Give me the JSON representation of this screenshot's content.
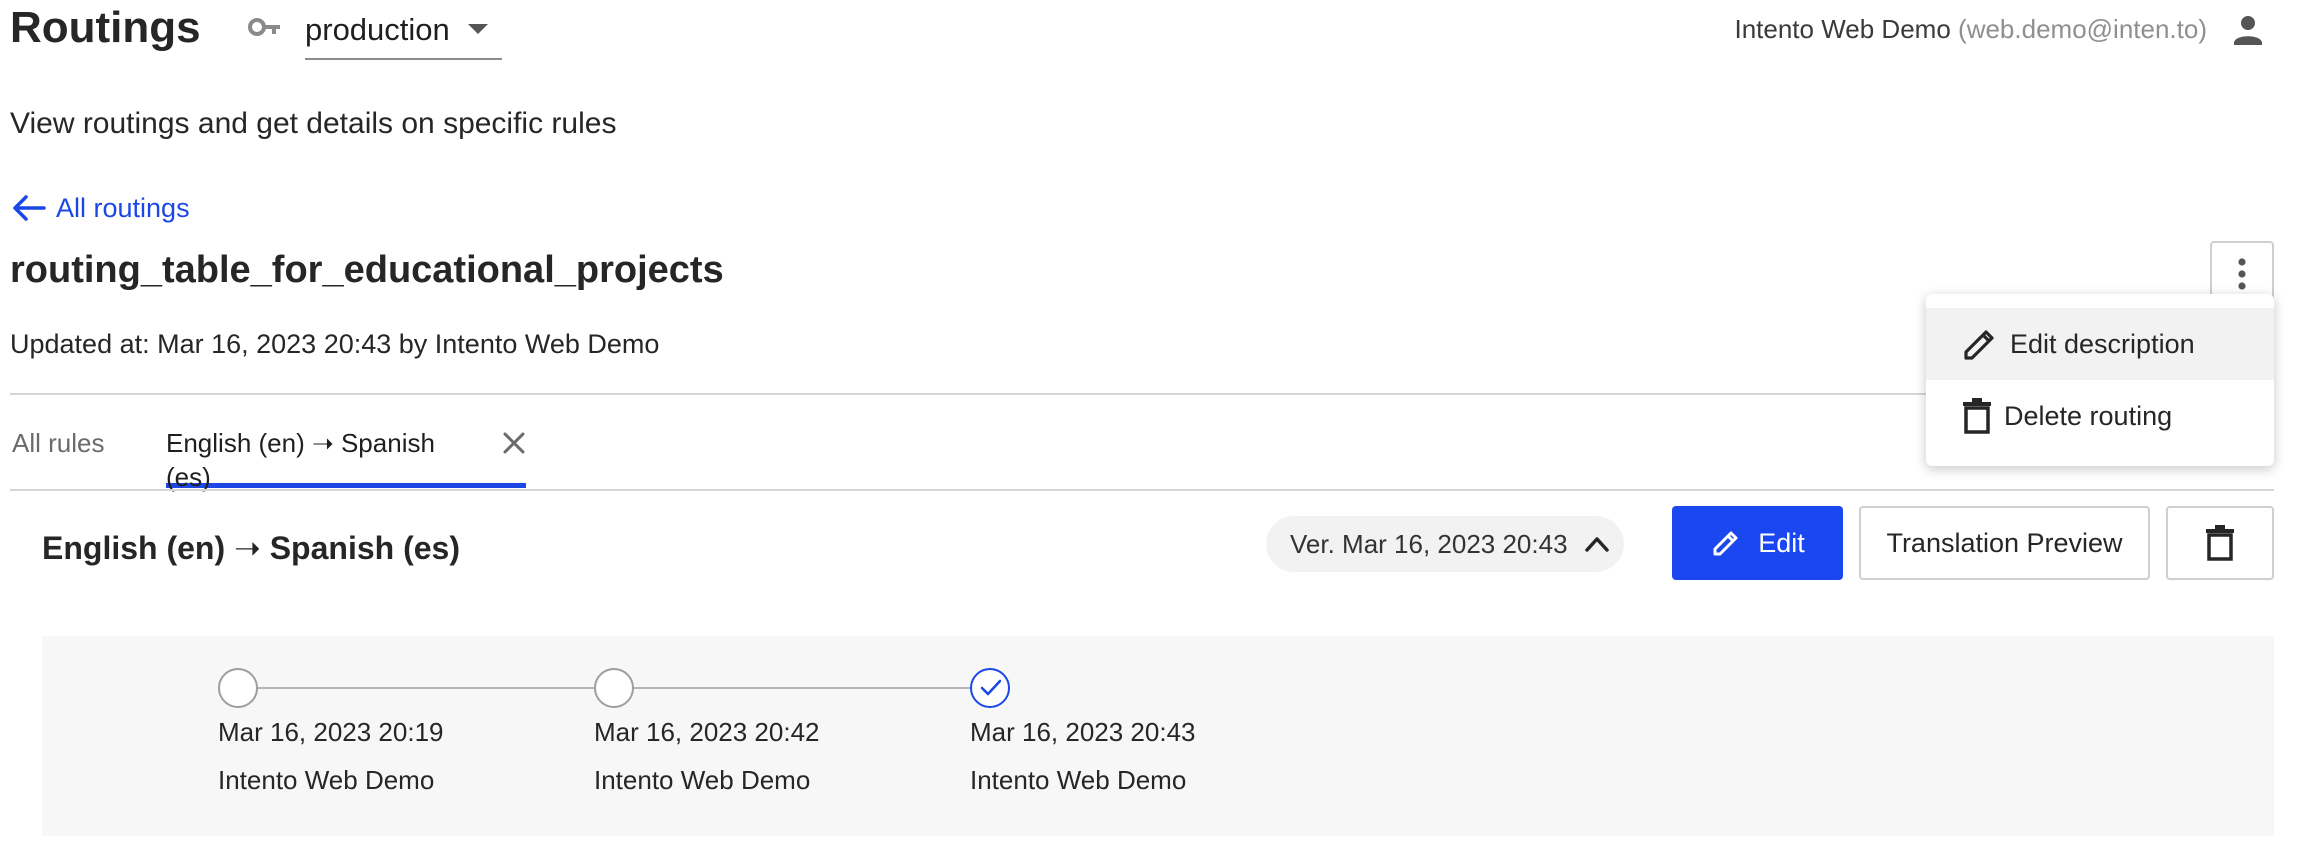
{
  "header": {
    "title": "Routings",
    "environment": "production",
    "user_name": "Intento Web Demo",
    "user_email": "(web.demo@inten.to)"
  },
  "subtitle": "View routings and get details on specific rules",
  "back_link": "All routings",
  "routing": {
    "name": "routing_table_for_educational_projects",
    "updated": "Updated at: Mar 16, 2023 20:43 by Intento Web Demo"
  },
  "tabs": [
    {
      "label": "All rules"
    },
    {
      "label": "English (en) ➝ Spanish (es)"
    }
  ],
  "rule": {
    "title": "English (en) ➝ Spanish (es)",
    "version": "Ver. Mar 16, 2023 20:43",
    "edit_label": "Edit",
    "preview_label": "Translation Preview"
  },
  "history": [
    {
      "date": "Mar 16, 2023 20:19",
      "author": "Intento Web Demo",
      "current": false
    },
    {
      "date": "Mar 16, 2023 20:42",
      "author": "Intento Web Demo",
      "current": false
    },
    {
      "date": "Mar 16, 2023 20:43",
      "author": "Intento Web Demo",
      "current": true
    }
  ],
  "menu": {
    "items": [
      {
        "label": "Edit description",
        "icon": "pencil-icon"
      },
      {
        "label": "Delete routing",
        "icon": "trash-icon"
      }
    ]
  },
  "colors": {
    "accent": "#1a47e6",
    "primary_button": "#1b47f0",
    "panel_bg": "#f7f7f7"
  }
}
